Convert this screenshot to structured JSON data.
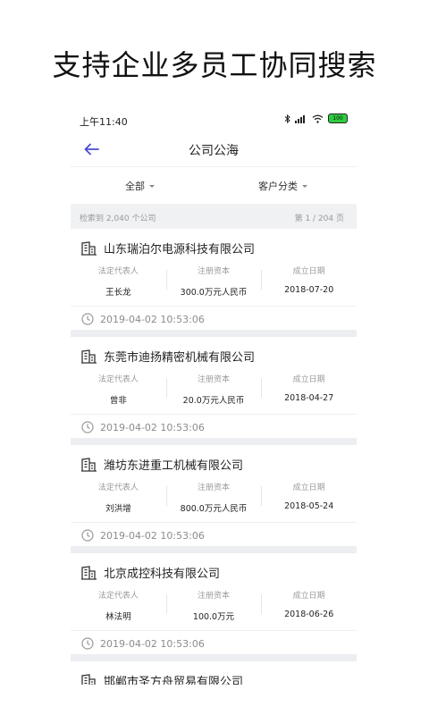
{
  "headline": "支持企业多员工协同搜索",
  "status": {
    "time": "上午11:40",
    "battery": "100"
  },
  "nav": {
    "title": "公司公海"
  },
  "filters": {
    "all": "全部",
    "category": "客户分类"
  },
  "summary": {
    "count_text": "检索到 2,040 个公司",
    "page_text": "第 1 / 204 页"
  },
  "labels": {
    "legal_rep": "法定代表人",
    "capital": "注册资本",
    "founded": "成立日期"
  },
  "companies": [
    {
      "name": "山东瑞泊尔电源科技有限公司",
      "legal_rep": "王长龙",
      "capital": "300.0万元人民币",
      "founded": "2018-07-20",
      "updated": "2019-04-02 10:53:06"
    },
    {
      "name": "东莞市迪扬精密机械有限公司",
      "legal_rep": "曾非",
      "capital": "20.0万元人民币",
      "founded": "2018-04-27",
      "updated": "2019-04-02 10:53:06"
    },
    {
      "name": "潍坊东进重工机械有限公司",
      "legal_rep": "刘洪增",
      "capital": "800.0万元人民币",
      "founded": "2018-05-24",
      "updated": "2019-04-02 10:53:06"
    },
    {
      "name": "北京成控科技有限公司",
      "legal_rep": "林法明",
      "capital": "100.0万元",
      "founded": "2018-06-26",
      "updated": "2019-04-02 10:53:06"
    }
  ],
  "partial_company": {
    "name": "邯郸市圣方舟贸易有限公司"
  },
  "colors": {
    "accent": "#4a4ad8",
    "summary_bg": "#f0f1f3",
    "divider": "#eceef1"
  }
}
